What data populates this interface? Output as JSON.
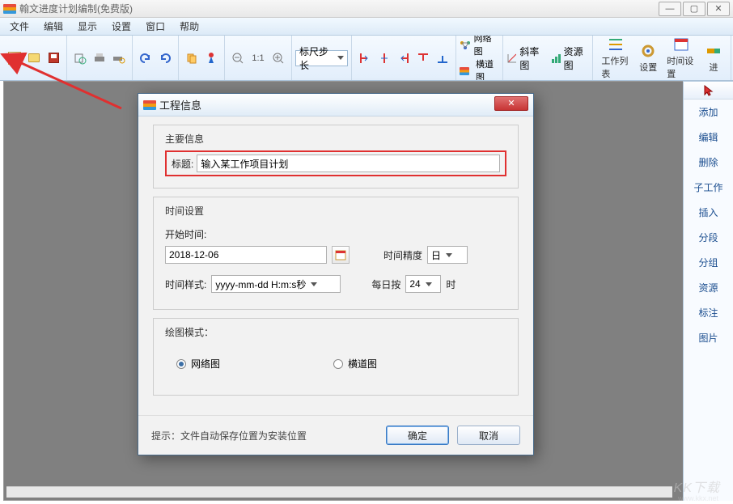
{
  "app": {
    "title": "翰文进度计划编制(免费版)"
  },
  "window_buttons": {
    "min": "—",
    "max": "▢",
    "close": "✕"
  },
  "menu": {
    "file": "文件",
    "edit": "编辑",
    "view": "显示",
    "settings": "设置",
    "window": "窗口",
    "help": "帮助"
  },
  "toolbar": {
    "step_select": "标尺步长",
    "view_group": {
      "network": "网络图",
      "gantt": "横道图"
    },
    "charts": {
      "slope": "斜率图",
      "resource": "资源图"
    },
    "big": {
      "worklist": "工作列表",
      "settings": "设置",
      "timesettings": "时间设置",
      "progress": "进"
    },
    "ratio": "1:1"
  },
  "sidebar": {
    "items": [
      "添加",
      "编辑",
      "删除",
      "子工作",
      "插入",
      "分段",
      "分组",
      "资源",
      "标注",
      "图片"
    ]
  },
  "dialog": {
    "title": "工程信息",
    "group_main": "主要信息",
    "label_title": "标题:",
    "title_value": "输入某工作项目计划",
    "group_time": "时间设置",
    "label_start": "开始时间:",
    "start_value": "2018-12-06",
    "label_precision": "时间精度",
    "precision_value": "日",
    "label_format": "时间样式:",
    "format_value": "yyyy-mm-dd H:m:s秒",
    "label_daily": "每日按",
    "daily_value": "24",
    "daily_suffix": "时",
    "group_mode": "绘图模式：",
    "radio_network": "网络图",
    "radio_gantt": "横道图",
    "hint": "提示：文件自动保存位置为安装位置",
    "ok": "确定",
    "cancel": "取消"
  },
  "watermark": {
    "main": "KK下载",
    "sub": "www.kkx.net"
  }
}
